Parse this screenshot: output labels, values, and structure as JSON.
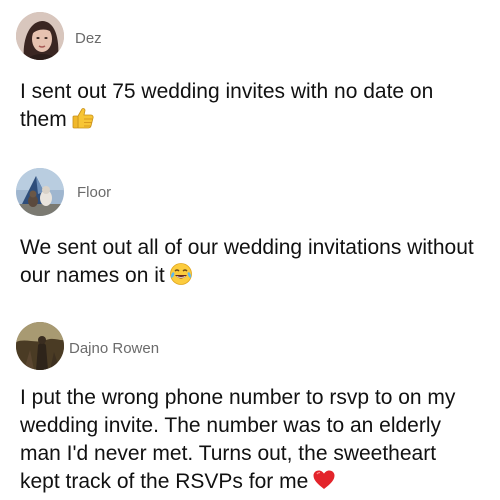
{
  "posts": [
    {
      "username": "Dez",
      "text": "I sent out 75 wedding invites with no date on them",
      "emoji": "thumbs-up-icon"
    },
    {
      "username": "Floor",
      "text": "We sent out all of our wedding invitations without our names on it",
      "emoji": "tears-of-joy-icon"
    },
    {
      "username": "Dajno Rowen",
      "text": "I put the wrong phone number to rsvp to on my wedding invite. The number was to an elderly man I'd never met. Turns out, the sweetheart kept track of the RSVPs for me",
      "emoji": "red-heart-icon"
    }
  ],
  "colors": {
    "username": "#6b6b6b",
    "body_text": "#111111",
    "background": "#ffffff"
  }
}
